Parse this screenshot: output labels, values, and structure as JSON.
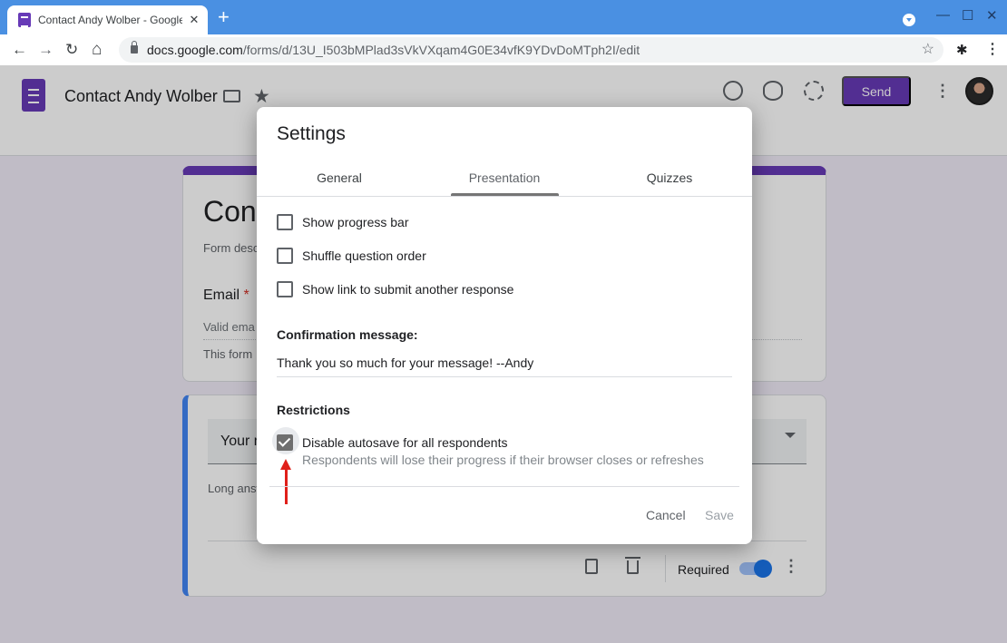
{
  "browser": {
    "tab_title": "Contact Andy Wolber - Google Fo",
    "tab_close": "✕",
    "new_tab": "+",
    "url_host": "docs.google.com",
    "url_path": "/forms/d/13U_I503bMPlad3sVkVXqam4G0E34vfK9YDvDoMTph2I/edit",
    "back_icon": "←",
    "forward_icon": "→",
    "reload_icon": "↻",
    "home_icon": "⌂",
    "bookmark_icon": "☆",
    "extensions_icon": "✱",
    "menu_icon": "⋮",
    "window_min": "—",
    "window_max": "☐",
    "window_close": "✕"
  },
  "app": {
    "form_title": "Contact Andy Wolber",
    "send_label": "Send",
    "more_icon": "⋮",
    "star_icon": "★",
    "icons": [
      "palette-icon",
      "eye-icon",
      "gear-icon",
      "folder-icon",
      "star-icon"
    ],
    "accent_color": "#673ab7"
  },
  "background_form": {
    "title_partial": "Cont",
    "description_partial": "Form desc",
    "question_label": "Email",
    "required_mark": "*",
    "shortanswer_partial": "Valid ema",
    "notice_partial": "This form",
    "question2_partial": "Your m",
    "longanswer_partial": "Long answ",
    "required_label": "Required",
    "kebab": "⋮"
  },
  "dialog": {
    "title": "Settings",
    "tabs": [
      {
        "label": "General",
        "active": false
      },
      {
        "label": "Presentation",
        "active": true
      },
      {
        "label": "Quizzes",
        "active": false
      }
    ],
    "options": [
      {
        "label": "Show progress bar",
        "checked": false
      },
      {
        "label": "Shuffle question order",
        "checked": false
      },
      {
        "label": "Show link to submit another response",
        "checked": false
      }
    ],
    "confirmation_label": "Confirmation message:",
    "confirmation_value": "Thank you so much for your message! --Andy",
    "restrictions_label": "Restrictions",
    "autosave_label": "Disable autosave for all respondents",
    "autosave_checked": true,
    "autosave_help": "Respondents will lose their progress if their browser closes or refreshes",
    "cancel_label": "Cancel",
    "save_label": "Save"
  }
}
